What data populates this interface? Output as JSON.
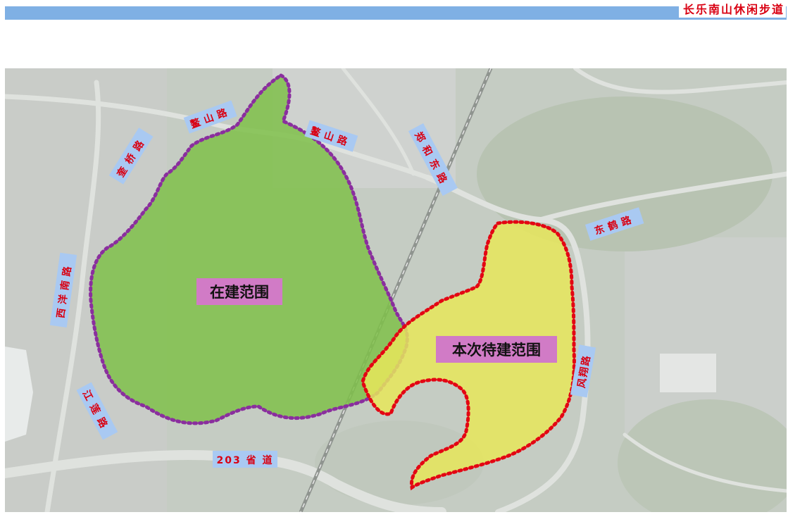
{
  "header": {
    "title": "长乐南山休闲步道"
  },
  "map": {
    "areas": {
      "built": {
        "label": "在建范围",
        "fill": "#7fbf4a",
        "border": "#8a2e9e"
      },
      "planned": {
        "label": "本次待建范围",
        "fill": "#e6e65a",
        "border": "#e30613"
      }
    },
    "roads": {
      "aoshan_1": "鳌山路",
      "aoshan_2": "鳌山路",
      "kuiqiao": "奎桥路",
      "zhenghe_east": "郑和东路",
      "donghe": "东鹤路",
      "xiyang_south": "西洋南路",
      "fengxiang": "风翔路",
      "jianglian": "江莲路",
      "provincial_203": "203 省 道"
    },
    "label_bg": "#a9c9f2",
    "label_text_color": "#d90012"
  }
}
